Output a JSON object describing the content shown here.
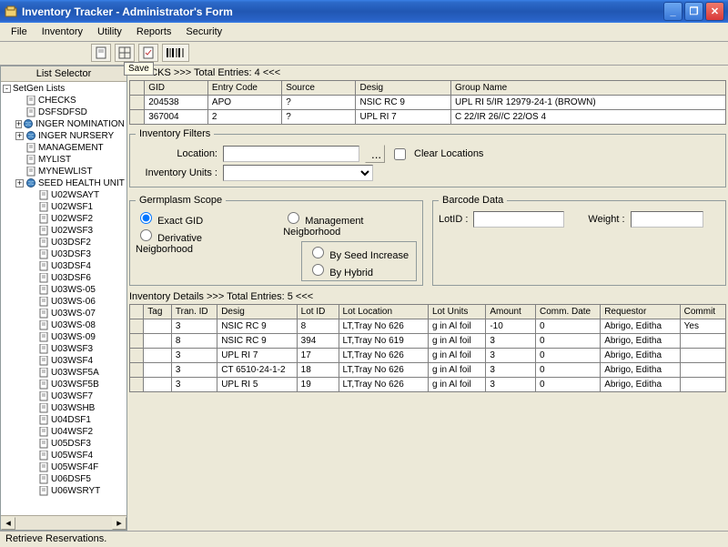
{
  "window": {
    "title": "Inventory Tracker - Administrator's Form"
  },
  "menu": [
    "File",
    "Inventory",
    "Utility",
    "Reports",
    "Security"
  ],
  "sidebar": {
    "header": "List Selector",
    "root": "SetGen Lists",
    "items": [
      {
        "label": "CHECKS",
        "icon": "doc"
      },
      {
        "label": "DSFSDFSD",
        "icon": "doc"
      },
      {
        "label": "INGER NOMINATION LI",
        "icon": "globe",
        "expand": "+"
      },
      {
        "label": "INGER NURSERY",
        "icon": "globe",
        "expand": "+"
      },
      {
        "label": "MANAGEMENT",
        "icon": "doc"
      },
      {
        "label": "MYLIST",
        "icon": "doc"
      },
      {
        "label": "MYNEWLIST",
        "icon": "doc"
      },
      {
        "label": "SEED HEALTH UNIT",
        "icon": "globe",
        "expand": "+"
      },
      {
        "label": "U02WSAYT",
        "icon": "doc",
        "lvl": 2
      },
      {
        "label": "U02WSF1",
        "icon": "doc",
        "lvl": 2
      },
      {
        "label": "U02WSF2",
        "icon": "doc",
        "lvl": 2
      },
      {
        "label": "U02WSF3",
        "icon": "doc",
        "lvl": 2
      },
      {
        "label": "U03DSF2",
        "icon": "doc",
        "lvl": 2
      },
      {
        "label": "U03DSF3",
        "icon": "doc",
        "lvl": 2
      },
      {
        "label": "U03DSF4",
        "icon": "doc",
        "lvl": 2
      },
      {
        "label": "U03DSF6",
        "icon": "doc",
        "lvl": 2
      },
      {
        "label": "U03WS-05",
        "icon": "doc",
        "lvl": 2
      },
      {
        "label": "U03WS-06",
        "icon": "doc",
        "lvl": 2
      },
      {
        "label": "U03WS-07",
        "icon": "doc",
        "lvl": 2
      },
      {
        "label": "U03WS-08",
        "icon": "doc",
        "lvl": 2
      },
      {
        "label": "U03WS-09",
        "icon": "doc",
        "lvl": 2
      },
      {
        "label": "U03WSF3",
        "icon": "doc",
        "lvl": 2
      },
      {
        "label": "U03WSF4",
        "icon": "doc",
        "lvl": 2
      },
      {
        "label": "U03WSF5A",
        "icon": "doc",
        "lvl": 2
      },
      {
        "label": "U03WSF5B",
        "icon": "doc",
        "lvl": 2
      },
      {
        "label": "U03WSF7",
        "icon": "doc",
        "lvl": 2
      },
      {
        "label": "U03WSHB",
        "icon": "doc",
        "lvl": 2
      },
      {
        "label": "U04DSF1",
        "icon": "doc",
        "lvl": 2
      },
      {
        "label": "U04WSF2",
        "icon": "doc",
        "lvl": 2
      },
      {
        "label": "U05DSF3",
        "icon": "doc",
        "lvl": 2
      },
      {
        "label": "U05WSF4",
        "icon": "doc",
        "lvl": 2
      },
      {
        "label": "U05WSF4F",
        "icon": "doc",
        "lvl": 2
      },
      {
        "label": "U06DSF5",
        "icon": "doc",
        "lvl": 2
      },
      {
        "label": "U06WSRYT",
        "icon": "doc",
        "lvl": 2
      }
    ]
  },
  "entries": {
    "caption": "CHECKS >>> Total Entries: 4 <<<",
    "headers": [
      "GID",
      "Entry Code",
      "Source",
      "Desig",
      "Group Name"
    ],
    "rows": [
      [
        "204538",
        "APO",
        "?",
        "NSIC RC 9",
        "UPL RI 5/IR 12979-24-1 (BROWN)"
      ],
      [
        "367004",
        "2",
        "?",
        "UPL RI 7",
        "C 22/IR 26//C 22/OS 4"
      ]
    ]
  },
  "filters": {
    "legend": "Inventory Filters",
    "location_label": "Location:",
    "units_label": "Inventory Units :",
    "browse": "...",
    "clear": "Clear Locations"
  },
  "scope": {
    "legend": "Germplasm Scope",
    "opt1": "Exact GID",
    "opt2": "Derivative Neigborhood",
    "opt3": "Management Neigborhood",
    "sub1": "By Seed Increase",
    "sub2": "By Hybrid"
  },
  "barcode": {
    "legend": "Barcode Data",
    "lotid_label": "LotID :",
    "weight_label": "Weight :"
  },
  "details": {
    "caption": "Inventory Details >>> Total Entries: 5 <<<",
    "headers": [
      "Tag",
      "Tran. ID",
      "Desig",
      "Lot ID",
      "Lot Location",
      "Lot Units",
      "Amount",
      "Comm. Date",
      "Requestor",
      "Commit"
    ],
    "rows": [
      [
        "",
        "3",
        "NSIC RC 9",
        "8",
        "LT,Tray No 626",
        "g in Al foil",
        "-10",
        "0",
        "Abrigo, Editha",
        "Yes"
      ],
      [
        "",
        "8",
        "NSIC RC 9",
        "394",
        "LT,Tray No 619",
        "g in Al foil",
        "3",
        "0",
        "Abrigo, Editha",
        ""
      ],
      [
        "",
        "3",
        "UPL RI 7",
        "17",
        "LT,Tray No 626",
        "g in Al foil",
        "3",
        "0",
        "Abrigo, Editha",
        ""
      ],
      [
        "",
        "3",
        "CT 6510-24-1-2",
        "18",
        "LT,Tray No 626",
        "g in Al foil",
        "3",
        "0",
        "Abrigo, Editha",
        ""
      ],
      [
        "",
        "3",
        "UPL RI 5",
        "19",
        "LT,Tray No 626",
        "g in Al foil",
        "3",
        "0",
        "Abrigo, Editha",
        ""
      ]
    ]
  },
  "status": "Retrieve Reservations.",
  "save_tab": "Save"
}
